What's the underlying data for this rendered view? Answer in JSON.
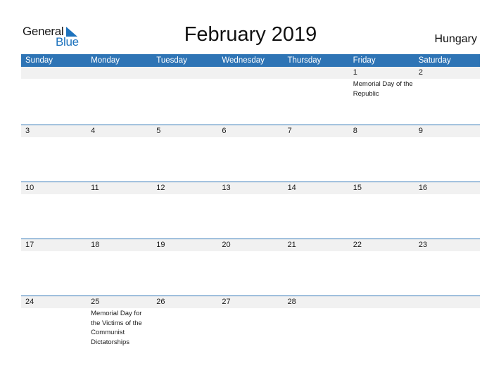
{
  "logo": {
    "general": "General",
    "blue": "Blue",
    "icon": "triangle-flag-icon",
    "brand_color": "#1e73be"
  },
  "title": "February 2019",
  "country": "Hungary",
  "colors": {
    "header_bg": "#2e74b5",
    "strip_bg": "#f1f1f1",
    "border": "#2e74b5"
  },
  "weekdays": [
    "Sunday",
    "Monday",
    "Tuesday",
    "Wednesday",
    "Thursday",
    "Friday",
    "Saturday"
  ],
  "weeks": [
    [
      {
        "day": ""
      },
      {
        "day": ""
      },
      {
        "day": ""
      },
      {
        "day": ""
      },
      {
        "day": ""
      },
      {
        "day": "1",
        "event": "Memorial Day of the Republic"
      },
      {
        "day": "2"
      }
    ],
    [
      {
        "day": "3"
      },
      {
        "day": "4"
      },
      {
        "day": "5"
      },
      {
        "day": "6"
      },
      {
        "day": "7"
      },
      {
        "day": "8"
      },
      {
        "day": "9"
      }
    ],
    [
      {
        "day": "10"
      },
      {
        "day": "11"
      },
      {
        "day": "12"
      },
      {
        "day": "13"
      },
      {
        "day": "14"
      },
      {
        "day": "15"
      },
      {
        "day": "16"
      }
    ],
    [
      {
        "day": "17"
      },
      {
        "day": "18"
      },
      {
        "day": "19"
      },
      {
        "day": "20"
      },
      {
        "day": "21"
      },
      {
        "day": "22"
      },
      {
        "day": "23"
      }
    ],
    [
      {
        "day": "24"
      },
      {
        "day": "25",
        "event": "Memorial Day for the Victims of the Communist Dictatorships"
      },
      {
        "day": "26"
      },
      {
        "day": "27"
      },
      {
        "day": "28"
      },
      {
        "day": ""
      },
      {
        "day": ""
      }
    ]
  ]
}
